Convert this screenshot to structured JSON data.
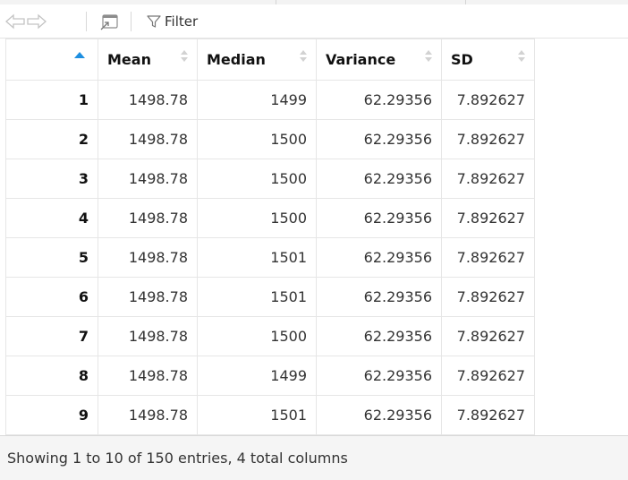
{
  "toolbar": {
    "filter_label": "Filter"
  },
  "table": {
    "columns": [
      {
        "label": ""
      },
      {
        "label": "Mean"
      },
      {
        "label": "Median"
      },
      {
        "label": "Variance"
      },
      {
        "label": "SD"
      }
    ],
    "rows": [
      {
        "idx": "1",
        "mean": "1498.78",
        "median": "1499",
        "variance": "62.29356",
        "sd": "7.892627"
      },
      {
        "idx": "2",
        "mean": "1498.78",
        "median": "1500",
        "variance": "62.29356",
        "sd": "7.892627"
      },
      {
        "idx": "3",
        "mean": "1498.78",
        "median": "1500",
        "variance": "62.29356",
        "sd": "7.892627"
      },
      {
        "idx": "4",
        "mean": "1498.78",
        "median": "1500",
        "variance": "62.29356",
        "sd": "7.892627"
      },
      {
        "idx": "5",
        "mean": "1498.78",
        "median": "1501",
        "variance": "62.29356",
        "sd": "7.892627"
      },
      {
        "idx": "6",
        "mean": "1498.78",
        "median": "1501",
        "variance": "62.29356",
        "sd": "7.892627"
      },
      {
        "idx": "7",
        "mean": "1498.78",
        "median": "1500",
        "variance": "62.29356",
        "sd": "7.892627"
      },
      {
        "idx": "8",
        "mean": "1498.78",
        "median": "1499",
        "variance": "62.29356",
        "sd": "7.892627"
      },
      {
        "idx": "9",
        "mean": "1498.78",
        "median": "1501",
        "variance": "62.29356",
        "sd": "7.892627"
      }
    ]
  },
  "footer": {
    "status": "Showing 1 to 10 of 150 entries, 4 total columns"
  },
  "colors": {
    "sort_active": "#1e8fe0",
    "sort_inactive": "#d2d2d2",
    "footer_bg": "#f5f5f5"
  },
  "icons": {
    "back": "back-arrow-icon",
    "forward": "forward-arrow-icon",
    "popout": "popout-window-icon",
    "filter": "filter-funnel-icon"
  }
}
